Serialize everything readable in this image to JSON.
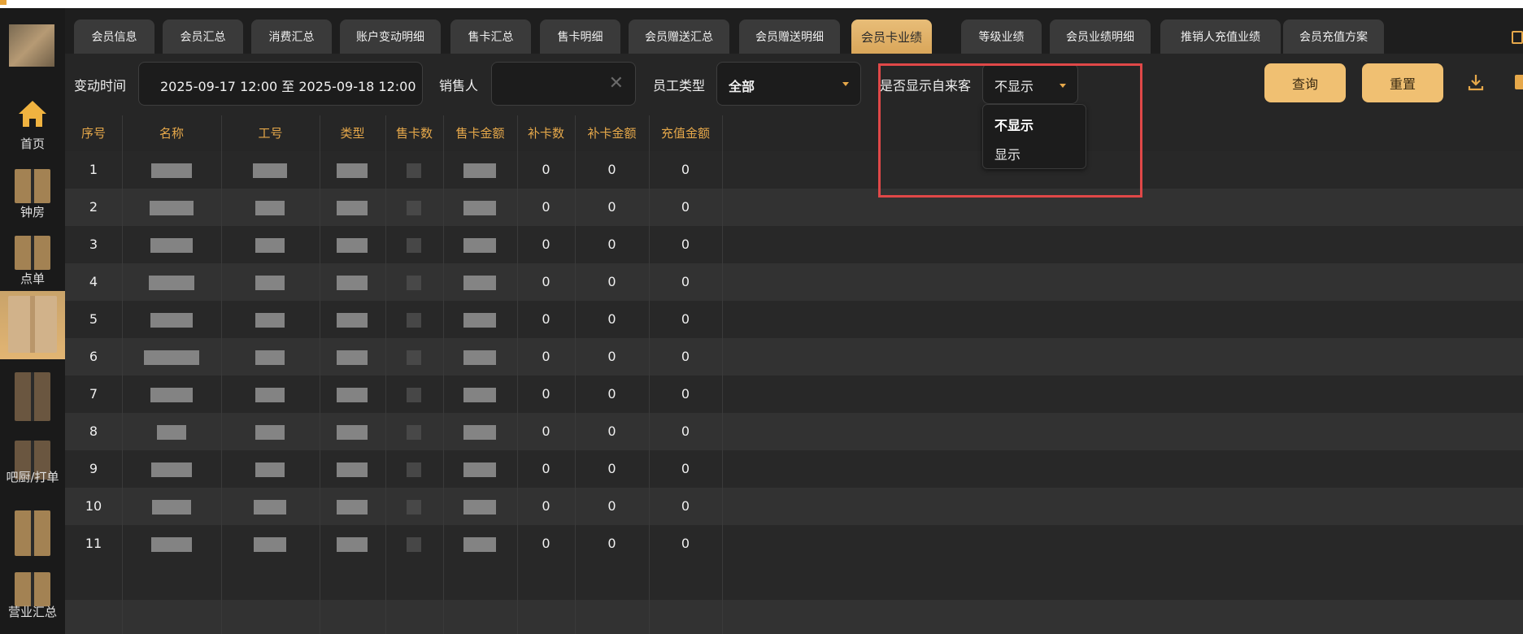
{
  "sidebar": {
    "items": [
      {
        "label": "首页"
      },
      {
        "label": "钟房"
      },
      {
        "label": "点单"
      },
      {
        "label": ""
      },
      {
        "label": ""
      },
      {
        "label": "吧厨/打单"
      },
      {
        "label": ""
      },
      {
        "label": "营业汇总"
      }
    ]
  },
  "tabs": [
    "会员信息",
    "会员汇总",
    "消费汇总",
    "账户变动明细",
    "售卡汇总",
    "售卡明细",
    "会员赠送汇总",
    "会员赠送明细",
    "会员卡业绩",
    "等级业绩",
    "会员业绩明细",
    "推销人充值业绩",
    "会员充值方案"
  ],
  "active_tab": "会员卡业绩",
  "filters": {
    "time_label": "变动时间",
    "time_value": "2025-09-17 12:00 至 2025-09-18 12:00",
    "seller_label": "销售人",
    "seller_value": "",
    "staff_type_label": "员工类型",
    "staff_type_value": "全部",
    "walkin_label": "是否显示自来客",
    "walkin_value": "不显示",
    "walkin_options": [
      "不显示",
      "显示"
    ],
    "query_label": "查询",
    "reset_label": "重置"
  },
  "table": {
    "columns": [
      "序号",
      "名称",
      "工号",
      "类型",
      "售卡数",
      "售卡金额",
      "补卡数",
      "补卡金额",
      "充值金额"
    ],
    "rows": [
      {
        "no": "1",
        "repair_count": "0",
        "repair_amount": "0",
        "recharge": "0"
      },
      {
        "no": "2",
        "repair_count": "0",
        "repair_amount": "0",
        "recharge": "0"
      },
      {
        "no": "3",
        "repair_count": "0",
        "repair_amount": "0",
        "recharge": "0"
      },
      {
        "no": "4",
        "repair_count": "0",
        "repair_amount": "0",
        "recharge": "0"
      },
      {
        "no": "5",
        "repair_count": "0",
        "repair_amount": "0",
        "recharge": "0"
      },
      {
        "no": "6",
        "repair_count": "0",
        "repair_amount": "0",
        "recharge": "0"
      },
      {
        "no": "7",
        "repair_count": "0",
        "repair_amount": "0",
        "recharge": "0"
      },
      {
        "no": "8",
        "repair_count": "0",
        "repair_amount": "0",
        "recharge": "0"
      },
      {
        "no": "9",
        "repair_count": "0",
        "repair_amount": "0",
        "recharge": "0"
      },
      {
        "no": "10",
        "repair_count": "0",
        "repair_amount": "0",
        "recharge": "0"
      },
      {
        "no": "11",
        "repair_count": "0",
        "repair_amount": "0",
        "recharge": "0"
      }
    ]
  },
  "colors": {
    "accent": "#e6a84a",
    "button": "#f0c072",
    "highlight_box": "#e04848"
  },
  "icons": {
    "home": "home-icon",
    "download": "download-icon",
    "print": "print-icon",
    "clear": "clear-icon",
    "calendar": "calendar-icon"
  }
}
